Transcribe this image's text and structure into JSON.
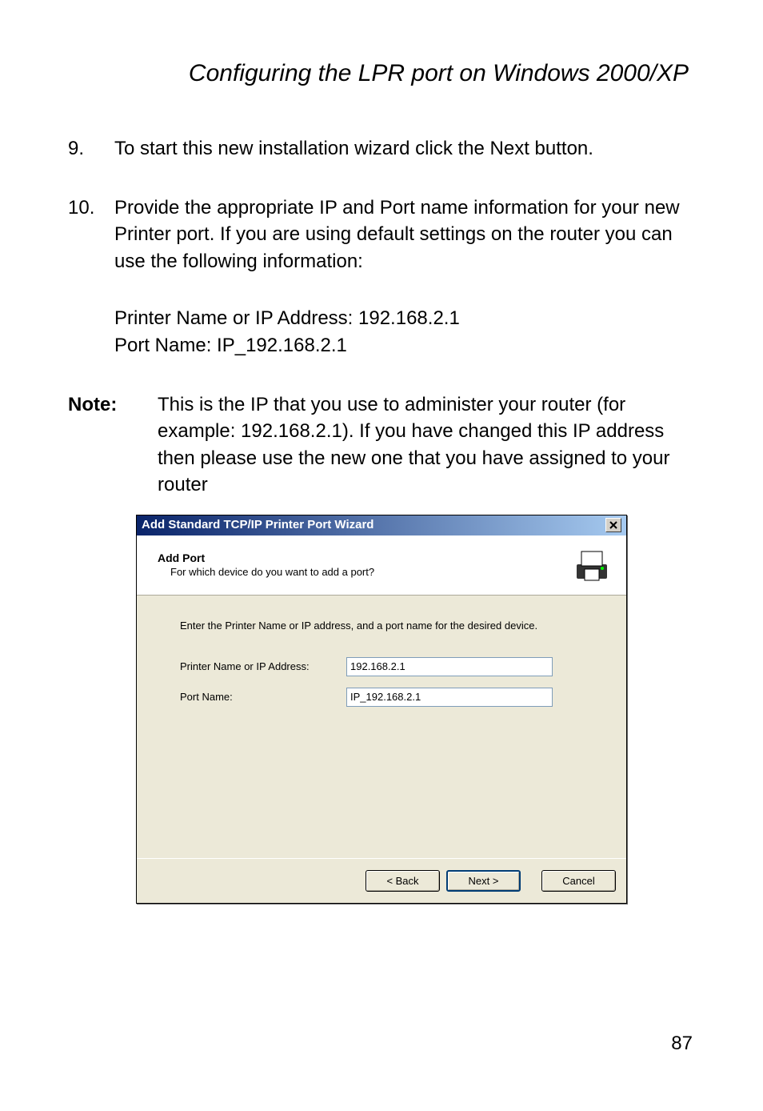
{
  "title": "Configuring the LPR port on Windows 2000/XP",
  "step9": {
    "num": "9.",
    "text": "To start this new installation wizard click the Next button."
  },
  "step10": {
    "num": "10.",
    "line1": "Provide the appropriate IP and Port name information for your new Printer port. If you are using default settings on the router you can use the following information:",
    "line2": "Printer Name or IP Address: 192.168.2.1",
    "line3": "Port Name: IP_192.168.2.1"
  },
  "note": {
    "label": "Note:",
    "text": "This is the IP that you use to administer your router (for example: 192.168.2.1). If you have changed this IP address then please use the new one that you have assigned to your router"
  },
  "dialog": {
    "title": "Add Standard TCP/IP Printer Port Wizard",
    "header": {
      "title": "Add Port",
      "sub": "For which device do you want to add a port?"
    },
    "instruction": "Enter the Printer Name or IP address, and a port name for the desired device.",
    "fields": {
      "ip_label": "Printer Name or IP Address:",
      "ip_value": "192.168.2.1",
      "port_label": "Port Name:",
      "port_value": "IP_192.168.2.1"
    },
    "buttons": {
      "back": "< Back",
      "next": "Next >",
      "cancel": "Cancel"
    }
  },
  "page_number": "87"
}
